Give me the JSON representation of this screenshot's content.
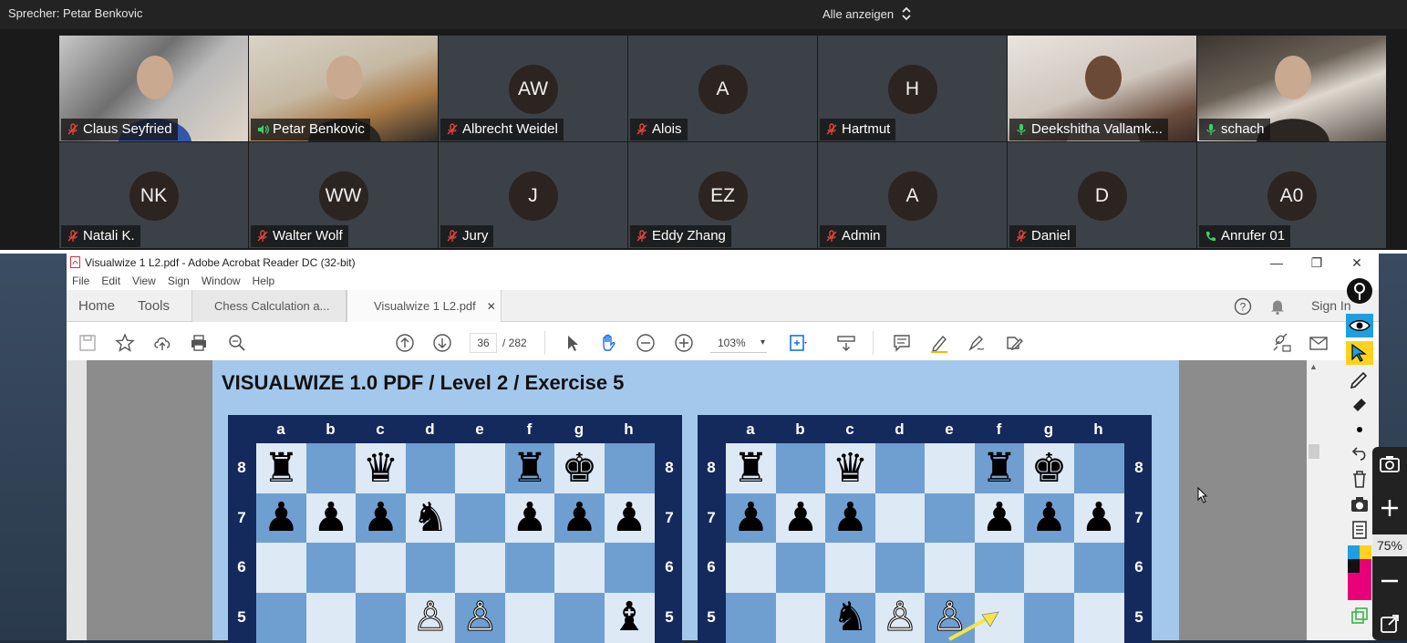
{
  "zoom": {
    "speaker_text": "Sprecher: Petar Benkovic",
    "view_all_label": "Alle anzeigen",
    "participants_row1": [
      {
        "name": "Claus Seyfried",
        "initials": "",
        "mic": "muted",
        "video": true
      },
      {
        "name": "Petar Benkovic",
        "initials": "",
        "mic": "speaking",
        "video": true
      },
      {
        "name": "Albrecht Weidel",
        "initials": "AW",
        "mic": "muted",
        "video": false
      },
      {
        "name": "Alois",
        "initials": "A",
        "mic": "muted",
        "video": false
      },
      {
        "name": "Hartmut",
        "initials": "H",
        "mic": "muted",
        "video": false
      },
      {
        "name": "Deekshitha Vallamk...",
        "initials": "",
        "mic": "on",
        "video": true
      },
      {
        "name": "schach",
        "initials": "",
        "mic": "on",
        "video": true
      }
    ],
    "participants_row2": [
      {
        "name": "Natali K.",
        "initials": "NK",
        "mic": "muted"
      },
      {
        "name": "Walter Wolf",
        "initials": "WW",
        "mic": "muted"
      },
      {
        "name": "Jury",
        "initials": "J",
        "mic": "muted"
      },
      {
        "name": "Eddy Zhang",
        "initials": "EZ",
        "mic": "muted"
      },
      {
        "name": "Admin",
        "initials": "A",
        "mic": "muted"
      },
      {
        "name": "Daniel",
        "initials": "D",
        "mic": "muted"
      },
      {
        "name": "Anrufer 01",
        "initials": "A0",
        "mic": "phone"
      }
    ]
  },
  "acrobat": {
    "window_title": "Visualwize 1 L2.pdf - Adobe Acrobat Reader DC (32-bit)",
    "menu": [
      "File",
      "Edit",
      "View",
      "Sign",
      "Window",
      "Help"
    ],
    "tabs": {
      "home": "Home",
      "tools": "Tools",
      "doc1": "Chess Calculation a...",
      "doc2": "Visualwize 1 L2.pdf"
    },
    "sign_in": "Sign In",
    "page_current": "36",
    "page_total": "/ 282",
    "zoom_level": "103%",
    "colors": {
      "accent": "#1473e6",
      "page_bg": "#a4c8ec",
      "board_frame": "#142a5c"
    }
  },
  "pdf": {
    "heading": "VISUALWIZE 1.0 PDF / Level 2 / Exercise 5",
    "files": [
      "a",
      "b",
      "c",
      "d",
      "e",
      "f",
      "g",
      "h"
    ],
    "ranks": [
      "8",
      "7",
      "6",
      "5"
    ],
    "board_left": [
      [
        "♜",
        "",
        "♛",
        "",
        "",
        "♜",
        "♚",
        ""
      ],
      [
        "♟",
        "♟",
        "♟",
        "♞",
        "",
        "♟",
        "♟",
        "♟"
      ],
      [
        "",
        "",
        "",
        "",
        "",
        "",
        "",
        ""
      ],
      [
        "",
        "",
        "",
        "♙",
        "♙",
        "",
        "",
        "♝"
      ]
    ],
    "board_right": [
      [
        "♜",
        "",
        "♛",
        "",
        "",
        "♜",
        "♚",
        ""
      ],
      [
        "♟",
        "♟",
        "♟",
        "",
        "",
        "♟",
        "♟",
        "♟"
      ],
      [
        "",
        "",
        "",
        "",
        "",
        "",
        "",
        ""
      ],
      [
        "",
        "",
        "♞",
        "♙",
        "♙",
        "",
        "",
        ""
      ]
    ]
  },
  "widget": {
    "zoom_percent": "75%"
  }
}
